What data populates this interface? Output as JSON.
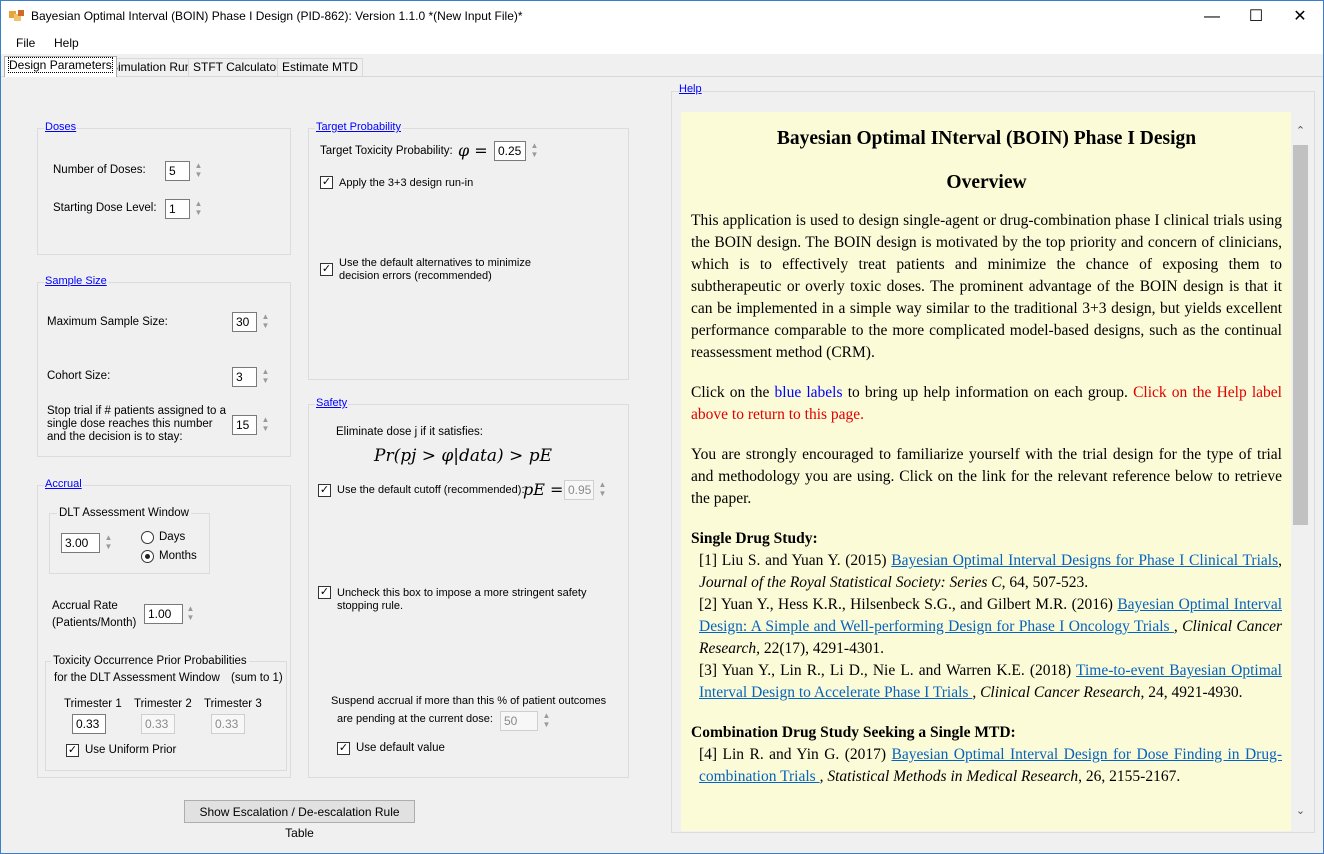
{
  "window": {
    "title": "Bayesian Optimal Interval (BOIN) Phase I Design (PID-862): Version 1.1.0    *(New Input File)*",
    "minimize": "—",
    "maximize": "☐",
    "close": "✕"
  },
  "menu": {
    "file": "File",
    "help": "Help"
  },
  "tabs": [
    "Design Parameters",
    "Simulation Run",
    "STFT Calculator",
    "Estimate MTD"
  ],
  "doses": {
    "title": "Doses",
    "num_label": "Number of Doses:",
    "num_value": "5",
    "start_label": "Starting Dose Level:",
    "start_value": "1"
  },
  "sample": {
    "title": "Sample Size",
    "max_label": "Maximum Sample Size:",
    "max_value": "30",
    "cohort_label": "Cohort Size:",
    "cohort_value": "3",
    "stop_label": "Stop trial if # patients assigned to a single dose reaches this number and the decision is to stay:",
    "stop_value": "15"
  },
  "accrual": {
    "title": "Accrual",
    "dlt_title": "DLT Assessment Window",
    "dlt_value": "3.00",
    "days": "Days",
    "months": "Months",
    "rate_label_1": "Accrual Rate",
    "rate_label_2": "(Patients/Month)",
    "rate_value": "1.00",
    "prior_title": "Toxicity Occurrence Prior Probabilities",
    "prior_sub": "for the DLT Assessment Window",
    "sum_note": "(sum to 1)",
    "tri1": "Trimester 1",
    "tri2": "Trimester 2",
    "tri3": "Trimester 3",
    "tri1_value": "0.33",
    "tri2_value": "0.33",
    "tri3_value": "0.33",
    "uniform_label": "Use Uniform Prior"
  },
  "target": {
    "title": "Target Probability",
    "tox_label": "Target Toxicity Probability:",
    "phi_sym": "φ =",
    "tox_value": "0.25",
    "runin_label": "Apply the 3+3 design run-in",
    "default_alt_label": "Use the default alternatives to minimize decision errors (recommended)"
  },
  "safety": {
    "title": "Safety",
    "elim_label": "Eliminate dose j if it satisfies:",
    "formula": "Pr(pj > φ|data) > pE",
    "cutoff_label": "Use the default cutoff (recommended):",
    "pe_sym": "pE =",
    "cutoff_value": "0.95",
    "uncheck_label": "Uncheck this box to impose a more stringent safety stopping rule.",
    "suspend_label_1": "Suspend accrual if more than this  %  of patient outcomes",
    "suspend_label_2": "are pending at the current dose:",
    "suspend_value": "50",
    "default_val_label": "Use default value"
  },
  "rule_button": "Show Escalation / De-escalation Rule Table",
  "help": {
    "link": "Help",
    "heading": "Bayesian Optimal INterval (BOIN) Phase I Design",
    "subheading": "Overview",
    "p1": "This application is used to design single-agent or drug-combination phase I clinical trials using the BOIN design. The BOIN design is motivated by the top priority and concern of clinicians, which is to effectively treat patients and minimize the chance of exposing them to subtherapeutic or overly toxic doses. The prominent advantage of the BOIN design is that it can be implemented in a simple way similar to the traditional 3+3 design, but yields excellent performance comparable to the more complicated model-based designs, such as the continual reassessment method (CRM).",
    "p2_a": "Click on the ",
    "p2_blue": "blue labels",
    "p2_b": " to bring up help information on each group. ",
    "p2_red": "Click on the Help label above to return to this page.",
    "p3": "You are strongly encouraged to familiarize yourself with the trial design for the type of trial and methodology you are using. Click on the link for the relevant reference below to retrieve the paper.",
    "single_title": "Single Drug Study:",
    "refs": [
      {
        "pre": "[1] Liu S. and Yuan Y. (2015) ",
        "link": "Bayesian Optimal Interval Designs for Phase I Clinical Trials",
        "journal": "Journal of the Royal Statistical Society: Series C",
        "post": ", 64, 507-523."
      },
      {
        "pre": "[2] Yuan Y., Hess K.R., Hilsenbeck S.G., and Gilbert M.R. (2016) ",
        "link": "Bayesian Optimal Interval Design: A Simple and Well-performing Design for Phase I Oncology Trials ",
        "journal": "Clinical Cancer Research,",
        "post": " 22(17), 4291-4301."
      },
      {
        "pre": "[3] Yuan Y., Lin R., Li D., Nie L. and Warren K.E. (2018) ",
        "link": "Time-to-event Bayesian Optimal Interval Design to Accelerate Phase I Trials ",
        "journal": "Clinical Cancer Research",
        "post": ", 24, 4921-4930."
      }
    ],
    "combo_title": "Combination Drug Study Seeking a Single MTD:",
    "ref4": {
      "pre": "[4] Lin R. and Yin G. (2017) ",
      "link": "Bayesian Optimal Interval Design for Dose Finding in Drug-combination Trials ",
      "journal": "Statistical Methods in Medical Research",
      "post": ", 26, 2155-2167."
    }
  }
}
